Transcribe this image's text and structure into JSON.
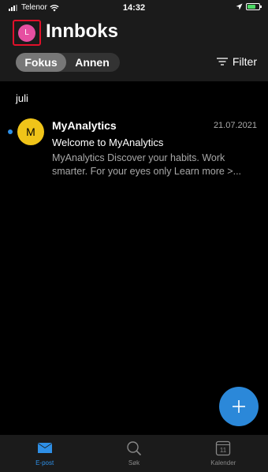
{
  "status_bar": {
    "carrier": "Telenor",
    "time": "14:32"
  },
  "header": {
    "avatar_initial": "L",
    "title": "Innboks",
    "tabs": [
      {
        "label": "Fokus",
        "active": true
      },
      {
        "label": "Annen",
        "active": false
      }
    ],
    "filter_label": "Filter"
  },
  "mail_list": {
    "section_label": "juli",
    "items": [
      {
        "avatar_initial": "M",
        "sender": "MyAnalytics",
        "date": "21.07.2021",
        "subject": "Welcome to MyAnalytics",
        "preview": "MyAnalytics Discover your habits. Work smarter. For your eyes only Learn more >...",
        "unread": true
      }
    ]
  },
  "tabbar": {
    "items": [
      {
        "label": "E-post",
        "icon": "mail-icon",
        "active": true
      },
      {
        "label": "Søk",
        "icon": "search-icon",
        "active": false
      },
      {
        "label": "Kalender",
        "icon": "calendar-icon",
        "active": false,
        "badge": "11"
      }
    ]
  },
  "colors": {
    "accent": "#2b88d9",
    "avatar_user": "#e64fa1",
    "avatar_sender": "#f0c419",
    "header_bg": "#1b1b1b"
  }
}
